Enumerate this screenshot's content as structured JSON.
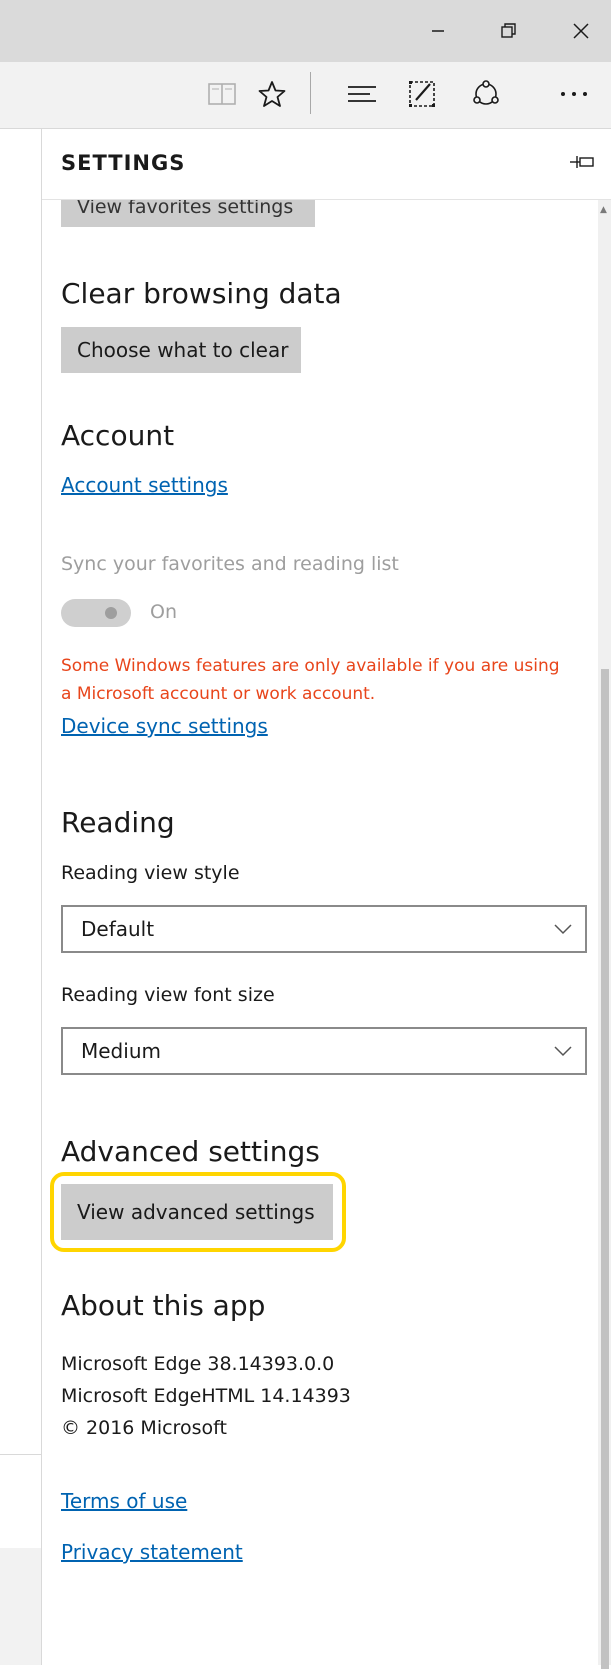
{
  "window": {
    "icons": [
      "minimize-icon",
      "restore-icon",
      "close-icon"
    ]
  },
  "toolbar": {
    "icons": [
      "reading-view-icon",
      "favorite-star-icon",
      "hub-icon",
      "web-note-icon",
      "share-icon",
      "more-icon"
    ]
  },
  "settings": {
    "title": "SETTINGS",
    "favorites": {
      "button_label": "View favorites settings"
    },
    "clear_data": {
      "heading": "Clear browsing data",
      "button_label": "Choose what to clear"
    },
    "account": {
      "heading": "Account",
      "link": "Account settings",
      "sync_label": "Sync your favorites and reading list",
      "sync_state": "On",
      "warning": "Some Windows features are only available if you are using a Microsoft account or work account.",
      "device_sync_link": "Device sync settings"
    },
    "reading": {
      "heading": "Reading",
      "style_label": "Reading view style",
      "style_value": "Default",
      "font_label": "Reading view font size",
      "font_value": "Medium"
    },
    "advanced": {
      "heading": "Advanced settings",
      "button_label": "View advanced settings"
    },
    "about": {
      "heading": "About this app",
      "lines": [
        "Microsoft Edge 38.14393.0.0",
        "Microsoft EdgeHTML 14.14393",
        "© 2016 Microsoft"
      ],
      "terms_link": "Terms of use",
      "privacy_link": "Privacy statement"
    }
  },
  "colors": {
    "accent_link": "#0063b1",
    "warning": "#e8451b",
    "highlight": "#ffd500",
    "button_gray": "#cccccc"
  }
}
